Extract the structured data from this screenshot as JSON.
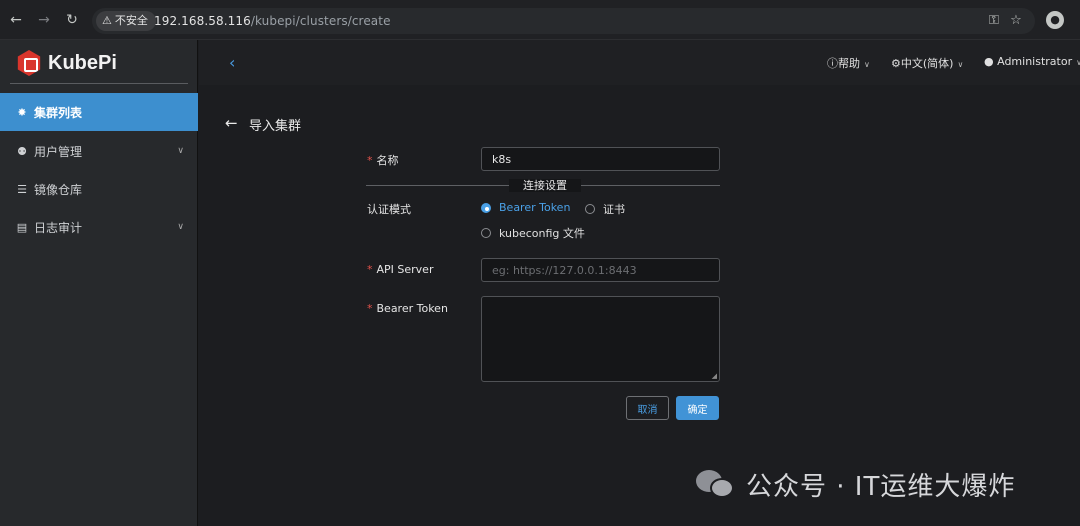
{
  "browser": {
    "insecure_label": "不安全",
    "url_host": "192.168.58.116",
    "url_path": "/kubepi/clusters/create"
  },
  "sidebar": {
    "logo_text": "KubePi",
    "items": [
      {
        "label": "集群列表",
        "icon": "cluster-icon",
        "active": true
      },
      {
        "label": "用户管理",
        "icon": "user-icon",
        "has_children": true
      },
      {
        "label": "镜像仓库",
        "icon": "layers-icon"
      },
      {
        "label": "日志审计",
        "icon": "log-icon",
        "has_children": true
      }
    ]
  },
  "header": {
    "help_label": "帮助",
    "language_label": "中文(简体)",
    "user_label": "Administrator"
  },
  "page": {
    "title": "导入集群"
  },
  "form": {
    "name_label": "名称",
    "name_value": "k8s",
    "section_label": "连接设置",
    "auth_mode_label": "认证模式",
    "auth_options": [
      "Bearer Token",
      "证书",
      "kubeconfig 文件"
    ],
    "auth_selected": "Bearer Token",
    "api_server_label": "API Server",
    "api_server_placeholder": "eg: https://127.0.0.1:8443",
    "bearer_token_label": "Bearer Token",
    "bearer_token_value": "",
    "cancel_label": "取消",
    "confirm_label": "确定"
  },
  "watermark": {
    "text": "公众号 · IT运维大爆炸"
  },
  "colors": {
    "accent": "#4193d6",
    "required": "#e3524b",
    "brand": "#d9352c"
  }
}
